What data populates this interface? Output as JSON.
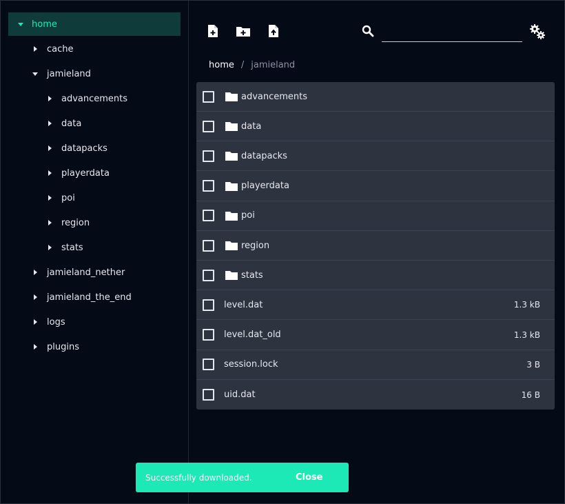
{
  "sidebar": {
    "root": {
      "label": "home",
      "expanded": true
    },
    "items": [
      {
        "label": "cache",
        "depth": 1,
        "expanded": false
      },
      {
        "label": "jamieland",
        "depth": 1,
        "expanded": true
      },
      {
        "label": "advancements",
        "depth": 2,
        "expanded": false
      },
      {
        "label": "data",
        "depth": 2,
        "expanded": false
      },
      {
        "label": "datapacks",
        "depth": 2,
        "expanded": false
      },
      {
        "label": "playerdata",
        "depth": 2,
        "expanded": false
      },
      {
        "label": "poi",
        "depth": 2,
        "expanded": false
      },
      {
        "label": "region",
        "depth": 2,
        "expanded": false
      },
      {
        "label": "stats",
        "depth": 2,
        "expanded": false
      },
      {
        "label": "jamieland_nether",
        "depth": 1,
        "expanded": false
      },
      {
        "label": "jamieland_the_end",
        "depth": 1,
        "expanded": false
      },
      {
        "label": "logs",
        "depth": 1,
        "expanded": false
      },
      {
        "label": "plugins",
        "depth": 1,
        "expanded": false
      }
    ]
  },
  "toolbar": {
    "icons": [
      "new-file-icon",
      "new-folder-icon",
      "upload-file-icon"
    ],
    "search": {
      "value": "",
      "placeholder": ""
    },
    "settings_icon": "gears-icon"
  },
  "breadcrumb": {
    "home": "home",
    "separator": "/",
    "current": "jamieland"
  },
  "files": [
    {
      "name": "advancements",
      "type": "folder",
      "size": ""
    },
    {
      "name": "data",
      "type": "folder",
      "size": ""
    },
    {
      "name": "datapacks",
      "type": "folder",
      "size": ""
    },
    {
      "name": "playerdata",
      "type": "folder",
      "size": ""
    },
    {
      "name": "poi",
      "type": "folder",
      "size": ""
    },
    {
      "name": "region",
      "type": "folder",
      "size": ""
    },
    {
      "name": "stats",
      "type": "folder",
      "size": ""
    },
    {
      "name": "level.dat",
      "type": "file",
      "size": "1.3 kB"
    },
    {
      "name": "level.dat_old",
      "type": "file",
      "size": "1.3 kB"
    },
    {
      "name": "session.lock",
      "type": "file",
      "size": "3 B"
    },
    {
      "name": "uid.dat",
      "type": "file",
      "size": "16 B"
    }
  ],
  "toast": {
    "message": "Successfully downloaded.",
    "close_label": "Close"
  },
  "colors": {
    "accent": "#1de9b6",
    "background": "#050a17",
    "panel": "#2e3340"
  }
}
